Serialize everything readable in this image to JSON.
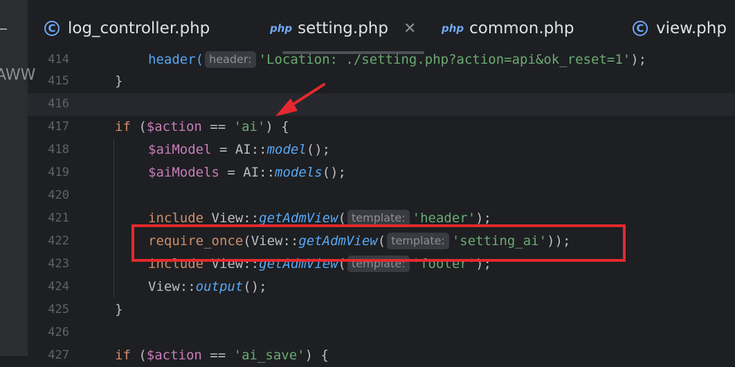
{
  "tabs": [
    {
      "icon": "class-icon",
      "icon_glyph": "C",
      "label": "log_controller.php",
      "active": false
    },
    {
      "icon": "php-file-icon",
      "icon_glyph": "php",
      "label": "setting.php",
      "active": true,
      "close": "✕"
    },
    {
      "icon": "php-file-icon",
      "icon_glyph": "php",
      "label": "common.php",
      "active": false
    },
    {
      "icon": "class-icon",
      "icon_glyph": "C",
      "label": "view.php",
      "active": false
    }
  ],
  "left_strip_fragment": "AWW",
  "line_numbers": [
    "414",
    "415",
    "416",
    "417",
    "418",
    "419",
    "420",
    "421",
    "422",
    "423",
    "424",
    "425",
    "426",
    "427"
  ],
  "code": {
    "l414": {
      "fn": "header(",
      "hint": "header:",
      "str": "'Location: ./setting.php?action=api&ok_reset=1'",
      "tail": ");"
    },
    "l415": {
      "text": "}"
    },
    "l417": {
      "kw": "if",
      "open": " (",
      "var": "$action",
      "op": " == ",
      "str": "'ai'",
      "tail": ") {"
    },
    "l418": {
      "var": "$aiModel",
      "mid": " = AI::",
      "fn": "model",
      "tail": "();"
    },
    "l419": {
      "var": "$aiModels",
      "mid": " = AI::",
      "fn": "models",
      "tail": "();"
    },
    "l421": {
      "kw": "include",
      "mid": " View::",
      "fn": "getAdmView",
      "open": "(",
      "hint": "template:",
      "str": "'header'",
      "tail": ");"
    },
    "l422": {
      "kw": "require_once",
      "mid": "(View::",
      "fn": "getAdmView",
      "open": "(",
      "hint": "template:",
      "str": "'setting_ai'",
      "tail": "));"
    },
    "l423": {
      "kw": "include",
      "mid": " View::",
      "fn": "getAdmView",
      "open": "(",
      "hint": "template:",
      "str": "'footer'",
      "tail": ");"
    },
    "l424": {
      "mid": "View::",
      "fn": "output",
      "tail": "();"
    },
    "l425": {
      "text": "}"
    },
    "l427": {
      "kw": "if",
      "open": " (",
      "var": "$action",
      "op": " == ",
      "str": "'ai_save'",
      "tail": ") {"
    }
  },
  "annotation_colors": {
    "box": "#e5292e",
    "arrow": "#e5292e"
  }
}
